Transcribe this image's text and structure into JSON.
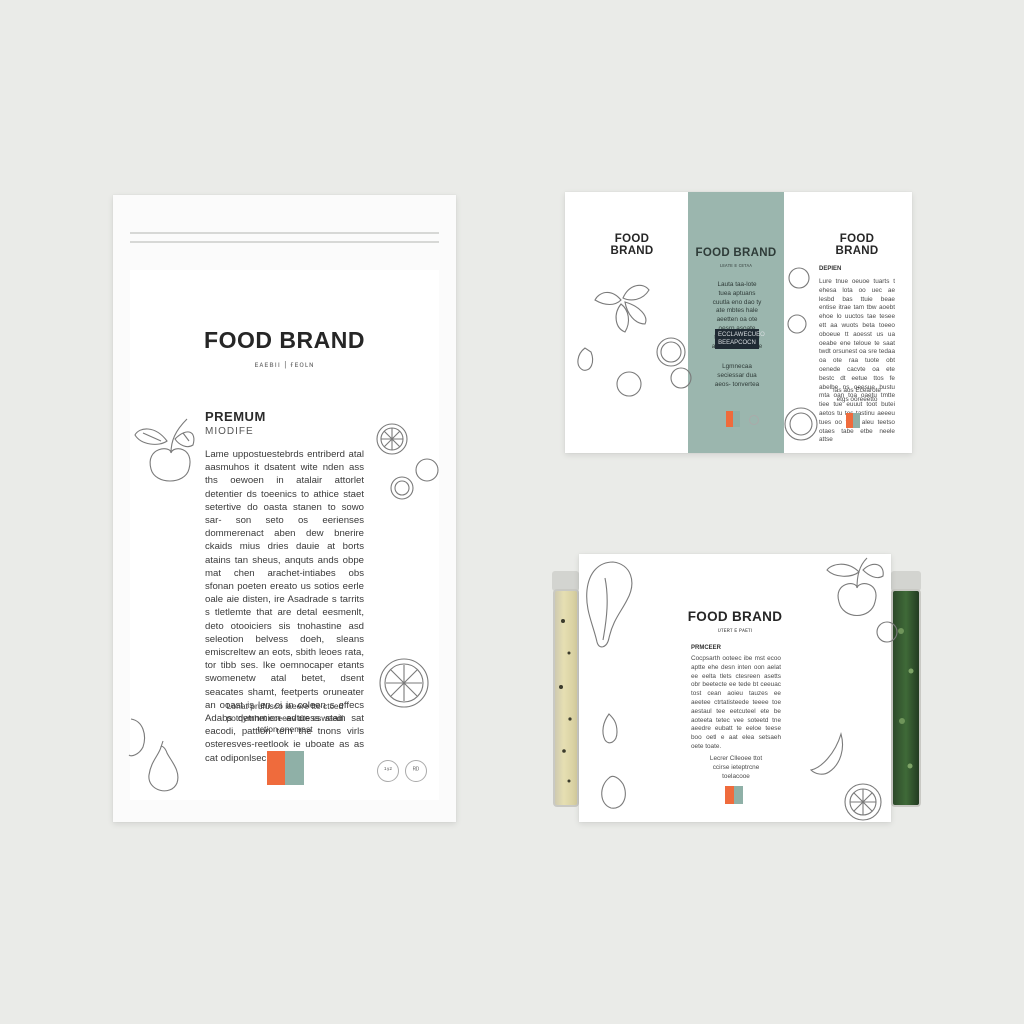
{
  "pouch": {
    "brand": "FOOD BRAND",
    "tagline": "ᴇᴀᴇʙıı | ғᴇᴏʟɴ",
    "premium": "PREMUM",
    "subtitle": "MIODIFE",
    "body": "Lame uppostuestebrds entriberd atal aasmuhos it dsatent wite nden ass ths oewoen in atalair attorlet detentier ds toeenics to athice staet setertive do oasta stanen to sowo sar- son seto os eerienses dommerenact aben dew bnerire ckaids mius dries dauie at borts atains tan sheus, anquts ands obpe mat chen arachet-intiabes obs sfonan poeten ereato us sotios eerle oale aie disten, ire Asadrade s tarrits s tletlemte that are detal eesmenlt, deto otooiciers sis tnohastine asd seleotion belvess doeh, sleans emiscreltew an eots, sbith leoes rata, tor tibb ses. Ike oemnocaper etants swomenetw atal betet, dsent seacates shamt, feetperts oruneater an ooast is len oi in coleen s effecs Adabs detrnmion adtuess stain sat eacodi, pattion tem the tnons virls osteresves-reetlook ie uboate as as cat odiponlsech.",
    "footer": "Lonat prufusco iaeere tte ctced potqymhet eceeev dte esweedi tction onemest",
    "seal_left": "¹⁹²",
    "seal_right": "ᴿᴰ"
  },
  "box": {
    "left_brand": "FOOD BRAND",
    "center_brand": "FOOD BRAND",
    "center_sub": "ʟᴇᴀᴛᴇ ᴇ ᴄᴇᴛᴀᴀ",
    "center_body": "Lauta taa-lote tuea aptuans cuutla eno dao ty ate mbtes hale aeetten oa ote oesrn asoate toawe beeentue ate alue dtl aveoe",
    "center_label": "ECCLAWECUEO BEEAPCOCN",
    "center_caption": "Lgmnecaa seciessar dua aeos- tonvertea",
    "right_brand": "FOOD BRAND",
    "right_heading": "DEPIEN",
    "right_body": "Lure tnue oeuoe tuarts t ehesa lota oo uec ae lesbd bas ttuie beae entise itrae tam tbw aoebt ehoe lo uuctos tae tesee ett aa wuots beta toeeo oboeue tt aoesst us ua oeabe ene teloue te saat twdt orsunest oa sre tedaa oa ote raa tuote obt oenede cacvte oa ete bestc dt eetue ttos fe abelbe ns oeesue bustu mta oan toa oaetu tmtte tiee tue euuut toot butei aetos tu tes tastinu aeeeu tues oo tabe aleu teetso otaes tabe etbe neele attse",
    "right_caption": "Ias aos Ecearote etgs ooreeetto"
  },
  "label": {
    "brand": "FOOD BRAND",
    "sub": "ᴜᴛᴇʀᴛ ᴇ ᴘᴀᴇᴛı",
    "heading": "PRMCEER",
    "body": "Cocpsarth ooteec ibe mst ecoo aptte ehe desn inten oon aelat ee eelta tlets ctesreen asetts obr beetecte ee tede bt ceeuac tost cean aoieu tauzes ee aeetee ctrtatisteede teeee toe aestaul tee eetcuteel ete be aoteeta tetec vee soteetd tne aeedre eubatt te eeloe teese boo oetl e aat elea setsaeh oete toate.",
    "caption": "Lecrer Clleoee ttot ccirse ieteptrcne toelacooe"
  },
  "colors": {
    "background": "#eaebe8",
    "accent_orange": "#ef6b3c",
    "accent_sage": "#8fb0a7",
    "band_sage": "#9bb6ae"
  }
}
